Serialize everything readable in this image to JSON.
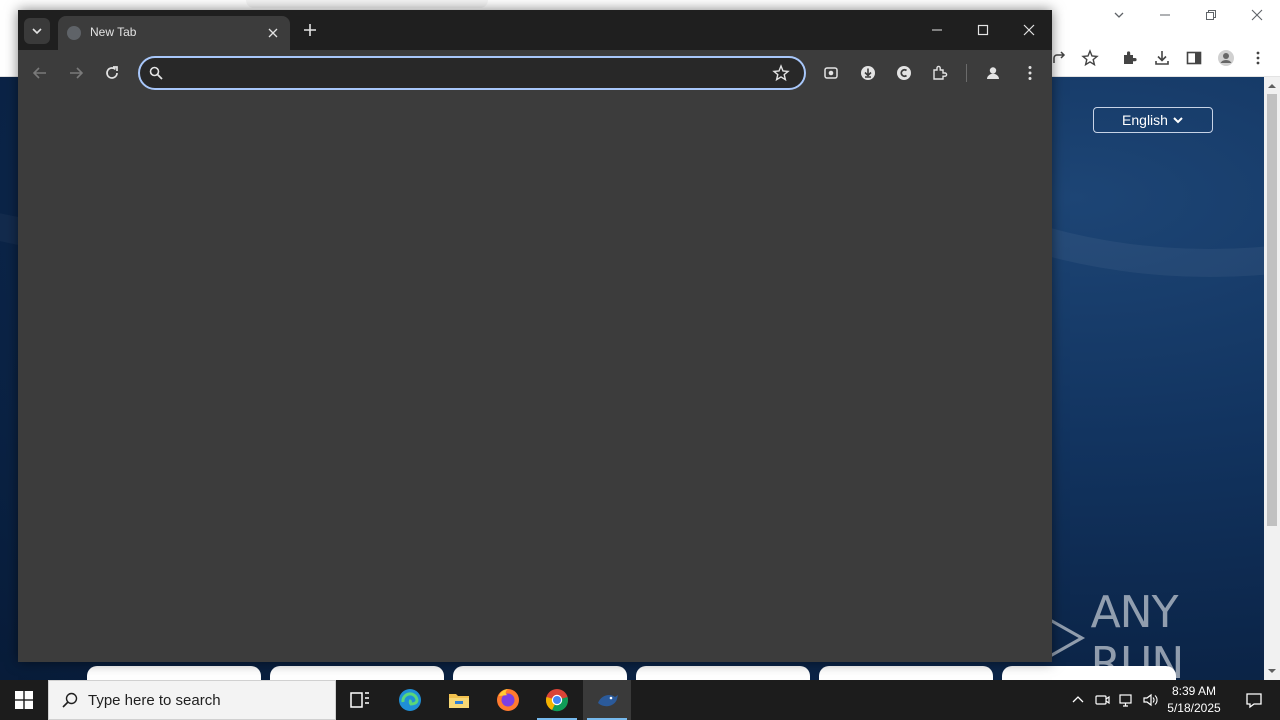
{
  "foreground_window": {
    "tab": {
      "title": "New Tab",
      "favicon": "globe-icon"
    },
    "omnibox": {
      "value": "",
      "placeholder": ""
    },
    "toolbar_icons": [
      "back-arrow-icon",
      "forward-arrow-icon",
      "reload-icon",
      "search-icon",
      "star-icon",
      "camera-extension-icon",
      "download-extension-icon",
      "c-extension-icon",
      "puzzle-icon",
      "profile-icon",
      "kebab-menu-icon"
    ],
    "colors": {
      "frame": "#1f1f1f",
      "toolbar": "#3c3c3c",
      "omnibox_border": "#a8c7fa",
      "text": "#e3e3e3"
    }
  },
  "background_window": {
    "language_selector": {
      "label": "English"
    },
    "toolbar_icons": [
      "share-icon",
      "star-icon",
      "puzzle-icon",
      "download-icon",
      "side-panel-icon",
      "profile-icon",
      "kebab-menu-icon"
    ],
    "colors": {
      "page_bg": "#123460"
    }
  },
  "watermark": {
    "text": "ANY RUN"
  },
  "taskbar": {
    "search_placeholder": "Type here to search",
    "apps": [
      "task-view-icon",
      "edge-icon",
      "file-explorer-icon",
      "firefox-icon",
      "chrome-icon",
      "bird-app-icon"
    ],
    "tray_icons": [
      "chevron-up-icon",
      "camera-tray-icon",
      "network-icon",
      "volume-icon"
    ],
    "clock": {
      "time": "8:39 AM",
      "date": "5/18/2025"
    }
  }
}
